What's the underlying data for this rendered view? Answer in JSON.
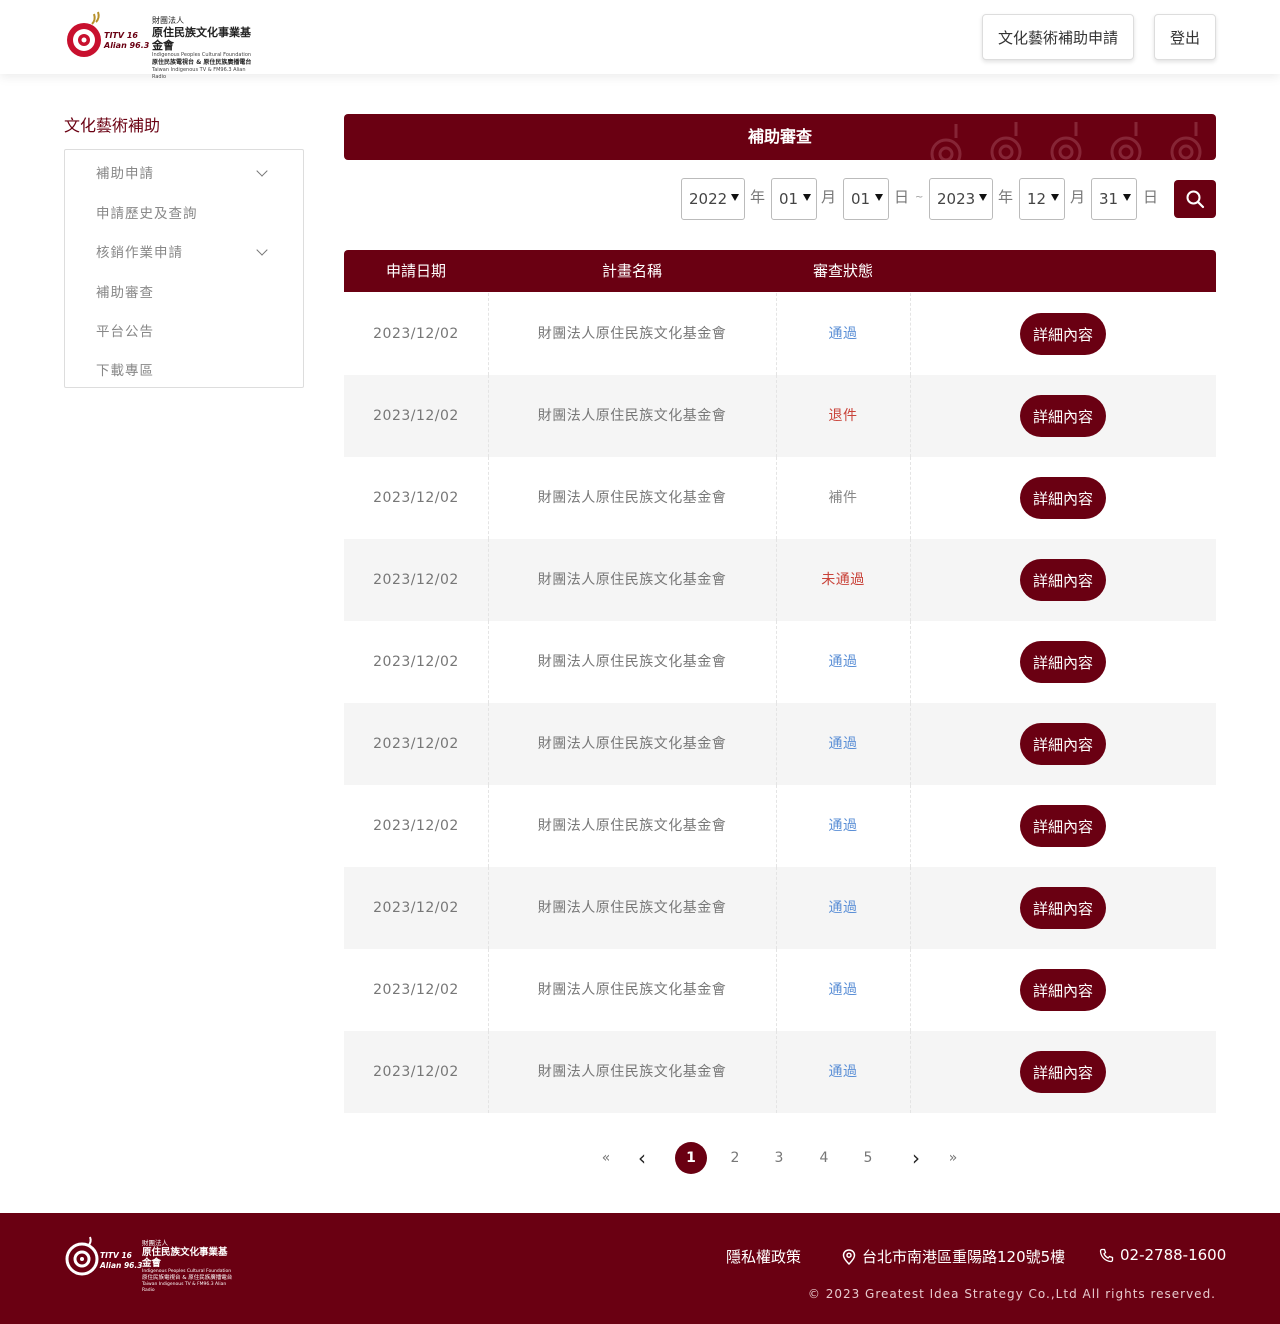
{
  "header": {
    "logo_org_small": "財團法人",
    "logo_org_name": "原住民族文化事業基金會",
    "logo_org_en": "Indigenous Peoples Cultural Foundation",
    "logo_tv": "原住民族電視台 & 原住民族廣播電台",
    "logo_tv_en": "Taiwan Indigenous TV & FM96.3 Alian Radio",
    "logo_titv": "TITV 16",
    "logo_alian": "Alian 96.3",
    "apply_label": "文化藝術補助申請",
    "logout_label": "登出"
  },
  "sidebar": {
    "title": "文化藝術補助",
    "items": [
      {
        "label": "補助申請"
      },
      {
        "label": "申請歷史及查詢"
      },
      {
        "label": "核銷作業申請"
      },
      {
        "label": "補助審查"
      },
      {
        "label": "平台公告"
      },
      {
        "label": "下載專區"
      }
    ]
  },
  "banner": {
    "title": "補助審查"
  },
  "filter": {
    "start_year": "2022",
    "start_month": "01",
    "start_day": "01",
    "end_year": "2023",
    "end_month": "12",
    "end_day": "31",
    "year_unit": "年",
    "month_unit": "月",
    "day_unit": "日",
    "tilde": "~"
  },
  "table": {
    "headers": [
      "申請日期",
      "計畫名稱",
      "審查狀態"
    ],
    "detail_label": "詳細內容",
    "rows": [
      {
        "date": "2023/12/02",
        "name": "財團法人原住民族文化基金會",
        "status": "通過"
      },
      {
        "date": "2023/12/02",
        "name": "財團法人原住民族文化基金會",
        "status": "退件"
      },
      {
        "date": "2023/12/02",
        "name": "財團法人原住民族文化基金會",
        "status": "補件"
      },
      {
        "date": "2023/12/02",
        "name": "財團法人原住民族文化基金會",
        "status": "未通過"
      },
      {
        "date": "2023/12/02",
        "name": "財團法人原住民族文化基金會",
        "status": "通過"
      },
      {
        "date": "2023/12/02",
        "name": "財團法人原住民族文化基金會",
        "status": "通過"
      },
      {
        "date": "2023/12/02",
        "name": "財團法人原住民族文化基金會",
        "status": "通過"
      },
      {
        "date": "2023/12/02",
        "name": "財團法人原住民族文化基金會",
        "status": "通過"
      },
      {
        "date": "2023/12/02",
        "name": "財團法人原住民族文化基金會",
        "status": "通過"
      },
      {
        "date": "2023/12/02",
        "name": "財團法人原住民族文化基金會",
        "status": "通過"
      }
    ]
  },
  "pagination": {
    "first": "«",
    "prev": "‹",
    "next": "›",
    "last": "»",
    "pages": [
      "1",
      "2",
      "3",
      "4",
      "5"
    ],
    "current": "1"
  },
  "footer": {
    "privacy": "隱私權政策",
    "address": "台北市南港區重陽路120號5樓",
    "phone": "02-2788-1600",
    "copyright": "© 2023 Greatest Idea Strategy Co.,Ltd All rights reserved."
  },
  "colors": {
    "brand": "#6a0012",
    "pass": "#5b8fd6",
    "reject": "#c9433a"
  }
}
